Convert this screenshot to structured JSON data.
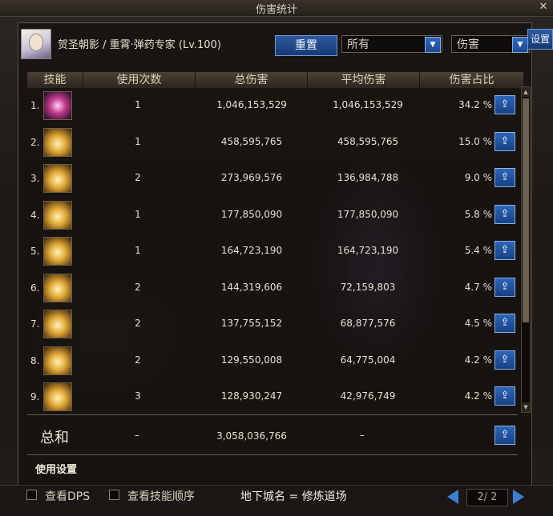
{
  "window": {
    "title": "伤害统计",
    "close_label": "✕"
  },
  "header": {
    "character": "贺圣朝影 / 重霄·弹药专家 (Lv.100)",
    "reset_label": "重置",
    "filter_value": "所有",
    "type_value": "伤害",
    "side_button_label": "设置"
  },
  "columns": [
    "技能",
    "使用次数",
    "总伤害",
    "平均伤害",
    "伤害占比"
  ],
  "rows": [
    {
      "idx": "1.",
      "icon": "skill-pink-orb-icon",
      "uses": "1",
      "total": "1,046,153,529",
      "avg": "1,046,153,529",
      "pct": "34.2 %"
    },
    {
      "idx": "2.",
      "icon": "skill-fire-pillar-icon",
      "uses": "1",
      "total": "458,595,765",
      "avg": "458,595,765",
      "pct": "15.0 %"
    },
    {
      "idx": "3.",
      "icon": "skill-flame-ring-icon",
      "uses": "2",
      "total": "273,969,576",
      "avg": "136,984,788",
      "pct": "9.0 %"
    },
    {
      "idx": "4.",
      "icon": "skill-slash-icon",
      "uses": "1",
      "total": "177,850,090",
      "avg": "177,850,090",
      "pct": "5.8 %"
    },
    {
      "idx": "5.",
      "icon": "skill-grenade-icon",
      "uses": "1",
      "total": "164,723,190",
      "avg": "164,723,190",
      "pct": "5.4 %"
    },
    {
      "idx": "6.",
      "icon": "skill-bullet-burst-icon",
      "uses": "2",
      "total": "144,319,606",
      "avg": "72,159,803",
      "pct": "4.7 %"
    },
    {
      "idx": "7.",
      "icon": "skill-spark-icon",
      "uses": "2",
      "total": "137,755,152",
      "avg": "68,877,576",
      "pct": "4.5 %"
    },
    {
      "idx": "8.",
      "icon": "skill-explosion-icon",
      "uses": "2",
      "total": "129,550,008",
      "avg": "64,775,004",
      "pct": "4.2 %"
    },
    {
      "idx": "9.",
      "icon": "skill-barrage-icon",
      "uses": "3",
      "total": "128,930,247",
      "avg": "42,976,749",
      "pct": "4.2 %"
    }
  ],
  "summary": {
    "label": "总和",
    "uses": "–",
    "total": "3,058,036,766",
    "avg": "–"
  },
  "settings_label": "使用设置",
  "footer": {
    "show_dps_label": "查看DPS",
    "show_order_label": "查看技能顺序",
    "dungeon": "地下城名 = 修炼道场",
    "page": "2/ 2"
  }
}
